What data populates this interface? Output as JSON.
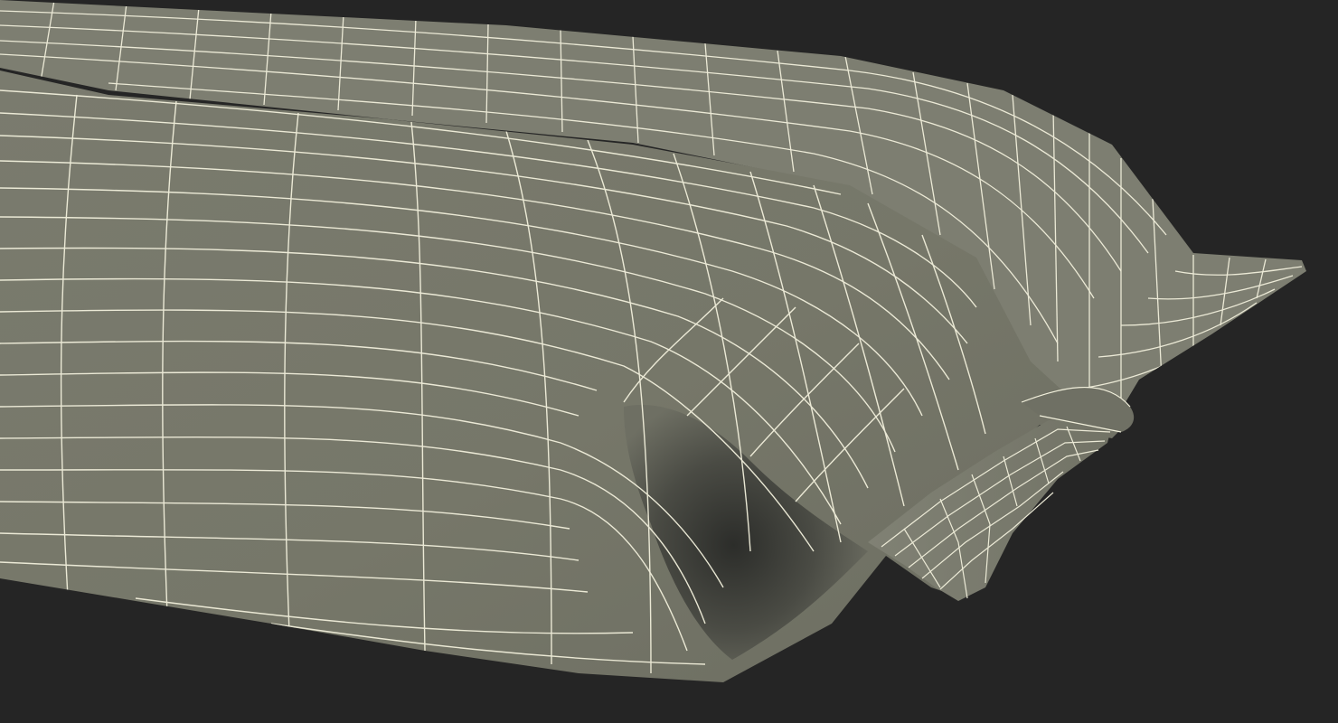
{
  "scene": {
    "subject": "wireframe-pouch-model",
    "colors": {
      "background": "#252525",
      "surface": "#797a6d",
      "surface_light": "#858678",
      "surface_dark": "#5f6056",
      "shadow": "#2f302c",
      "wire": "#f2f0dc"
    }
  }
}
